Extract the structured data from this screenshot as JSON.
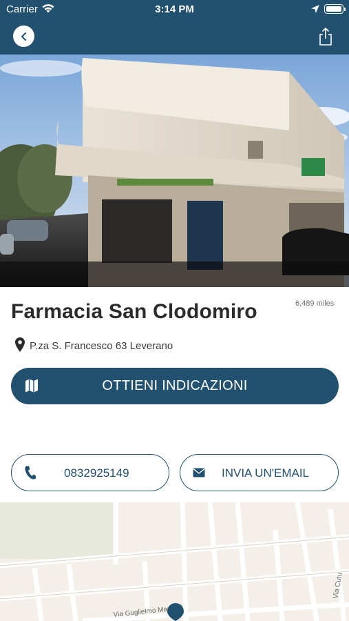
{
  "status_bar": {
    "carrier": "Carrier",
    "time": "3:14 PM"
  },
  "nav": {
    "back_icon": "chevron-left-icon",
    "share_icon": "share-icon",
    "bar_color": "#22506f"
  },
  "pharmacy": {
    "name": "Farmacia San Clodomiro",
    "distance": "6,489 miles",
    "address": "P.za S. Francesco 63 Leverano"
  },
  "actions": {
    "directions_label": "OTTIENI INDICAZIONI",
    "phone_label": "0832925149",
    "email_label": "INVIA UN'EMAIL"
  },
  "map": {
    "street_1": "Via Guglielmo Marconi",
    "street_2": "Via Cutu"
  }
}
